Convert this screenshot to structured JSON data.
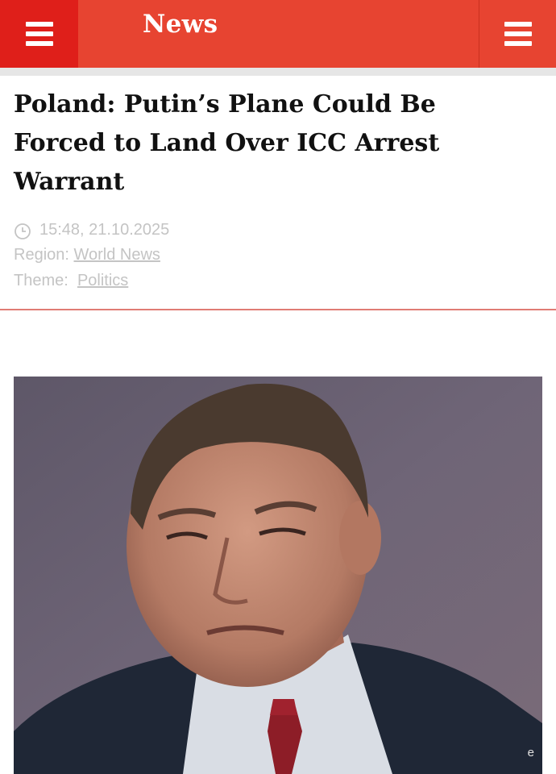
{
  "header": {
    "brand": "News",
    "left_menu_icon": "hamburger-menu-icon",
    "right_menu_icon": "hamburger-menu-icon",
    "background_color": "#e74431",
    "left_button_color": "#df1f1a"
  },
  "article": {
    "title": "Poland: Putin’s Plane Could Be Forced to Land Over ICC Arrest Warrant",
    "timestamp": "15:48, 21.10.2025",
    "clock_icon": "clock-icon",
    "region_label": "Region:",
    "region_value": "World News",
    "theme_label": "Theme:",
    "theme_value": "Politics",
    "photo": {
      "description_icon": "portrait-photo",
      "watermark": "e"
    }
  },
  "colors": {
    "meta_text": "#c4c4c4",
    "divider": "#e07c74",
    "headline": "#111111"
  }
}
